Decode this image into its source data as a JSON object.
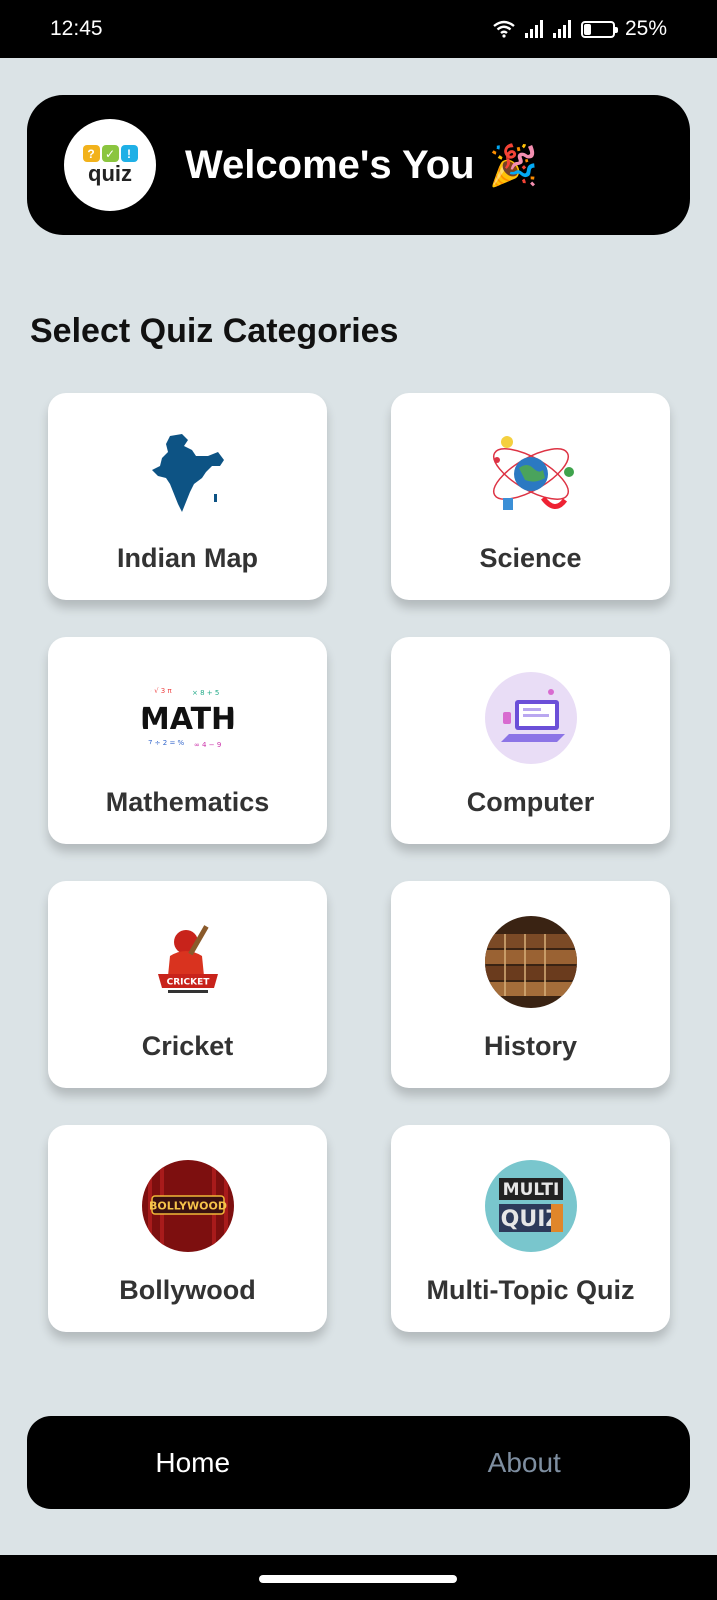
{
  "status_bar": {
    "time": "12:45",
    "battery": "25%",
    "battery_level": 0.25
  },
  "header": {
    "logo_text": "quiz",
    "logo_tiles": [
      "?",
      "✓",
      "!"
    ],
    "title": "Welcome's You",
    "emoji": "🎉"
  },
  "section_title": "Select Quiz Categories",
  "categories": [
    {
      "label": "Indian Map",
      "icon": "india-map-icon"
    },
    {
      "label": "Science",
      "icon": "science-icon"
    },
    {
      "label": "Mathematics",
      "icon": "math-icon",
      "icon_text": "MATH"
    },
    {
      "label": "Computer",
      "icon": "computer-icon"
    },
    {
      "label": "Cricket",
      "icon": "cricket-icon",
      "icon_text": "CRICKET"
    },
    {
      "label": "History",
      "icon": "history-books-icon"
    },
    {
      "label": "Bollywood",
      "icon": "bollywood-icon",
      "icon_text": "BOLLYWOOD"
    },
    {
      "label": "Multi-Topic Quiz",
      "icon": "multi-quiz-icon",
      "icon_text": [
        "MULTI",
        "QUIZ"
      ]
    }
  ],
  "bottom_nav": {
    "home": "Home",
    "about": "About"
  },
  "colors": {
    "background": "#dbe3e6",
    "header_bg": "#000000",
    "card_bg": "#ffffff",
    "nav_active": "#ffffff",
    "nav_inactive": "#7e8ea0"
  }
}
